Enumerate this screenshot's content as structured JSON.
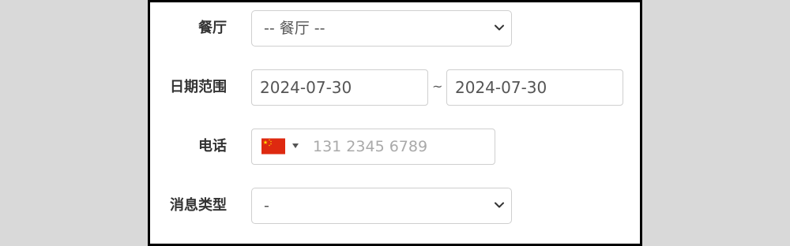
{
  "form": {
    "restaurant": {
      "label": "餐厅",
      "selected": "-- 餐厅 --"
    },
    "date_range": {
      "label": "日期范围",
      "start": "2024-07-30",
      "separator": "~",
      "end": "2024-07-30"
    },
    "phone": {
      "label": "电话",
      "flag_icon": "china-flag-icon",
      "placeholder": "131 2345 6789",
      "value": ""
    },
    "message_type": {
      "label": "消息类型",
      "selected": "-"
    }
  },
  "colors": {
    "background": "#d9d9d9",
    "panel": "#ffffff",
    "border": "#cfcfcf",
    "label_text": "#333333",
    "value_text": "#555555",
    "placeholder_text": "#a9a9a9",
    "flag_red": "#de2910",
    "flag_yellow": "#ffde00"
  }
}
